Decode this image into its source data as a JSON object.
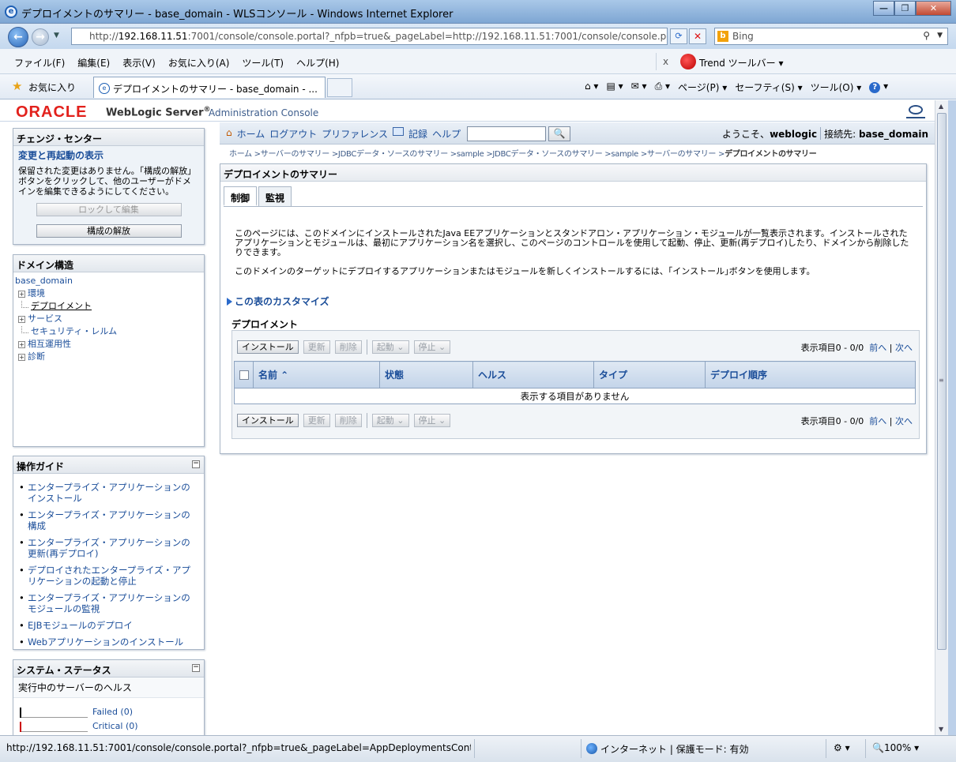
{
  "window": {
    "title": "デプロイメントのサマリー - base_domain - WLSコンソール - Windows Internet Explorer",
    "url_prefix": "http://",
    "url_host": "192.168.11.51",
    "url_rest": ":7001/console/console.portal?_nfpb=true&_pageLabel=http://192.168.11.51:7001/console/console.pc",
    "search_placeholder": "Bing"
  },
  "menubar": {
    "items": [
      "ファイル(F)",
      "編集(E)",
      "表示(V)",
      "お気に入り(A)",
      "ツール(T)",
      "ヘルプ(H)"
    ],
    "trend_close": "x",
    "trend_label": "Trend ツールバー ▾"
  },
  "favbar": {
    "favorites": "お気に入り",
    "tab_title": "デプロイメントのサマリー - base_domain - ...",
    "commands": [
      "ページ(P) ▾",
      "セーフティ(S) ▾",
      "ツール(O) ▾"
    ]
  },
  "console": {
    "oracle": "ORACLE",
    "product": "WebLogic Server",
    "reg": "®",
    "subtitle": "Administration Console"
  },
  "change_center": {
    "title": "チェンジ・センター",
    "link": "変更と再起動の表示",
    "message": "保留された変更はありません。｢構成の解放」ボタンをクリックして、他のユーザーがドメインを編集できるようにしてください。",
    "lock_button": "ロックして編集",
    "release_button": "構成の解放"
  },
  "domain_structure": {
    "title": "ドメイン構造",
    "root": "base_domain",
    "nodes": [
      {
        "label": "環境",
        "type": "plus"
      },
      {
        "label": "デプロイメント",
        "type": "leaf"
      },
      {
        "label": "サービス",
        "type": "plus"
      },
      {
        "label": "セキュリティ・レルム",
        "type": "leaf"
      },
      {
        "label": "相互運用性",
        "type": "plus"
      },
      {
        "label": "診断",
        "type": "plus"
      }
    ]
  },
  "how_to": {
    "title": "操作ガイド",
    "collapse": "−",
    "items": [
      "エンタープライズ・アプリケーションのインストール",
      "エンタープライズ・アプリケーションの構成",
      "エンタープライズ・アプリケーションの更新(再デプロイ)",
      "デプロイされたエンタープライズ・アプリケーションの起動と停止",
      "エンタープライズ・アプリケーションのモジュールの監視",
      "EJBモジュールのデプロイ",
      "Webアプリケーションのインストール"
    ]
  },
  "system_status": {
    "title": "システム・ステータス",
    "collapse": "−",
    "subtitle": "実行中のサーバーのヘルス",
    "rows": [
      {
        "label": "Failed (0)",
        "color": "#000000"
      },
      {
        "label": "Critical (0)",
        "color": "#cc0000"
      }
    ]
  },
  "topnav": {
    "home": "ホーム",
    "logout": "ログアウト",
    "preferences": "プリファレンス",
    "record": "記録",
    "help": "ヘルプ",
    "search_button": "🔍",
    "welcome": "ようこそ、",
    "user": "weblogic",
    "connected": "接続先:",
    "domain": "base_domain"
  },
  "breadcrumb": {
    "trail": "ホーム >サーバーのサマリー >JDBCデータ・ソースのサマリー >sample >JDBCデータ・ソースのサマリー >sample >サーバーのサマリー >",
    "current": "デプロイメントのサマリー"
  },
  "content": {
    "title": "デプロイメントのサマリー",
    "tabs": [
      "制御",
      "監視"
    ],
    "desc1": "このページには、このドメインにインストールされたJava EEアプリケーションとスタンドアロン・アプリケーション・モジュールが一覧表示されます。インストールされたアプリケーションとモジュールは、最初にアプリケーション名を選択し、このページのコントロールを使用して起動、停止、更新(再デプロイ)したり、ドメインから削除したりできます。",
    "desc2": "このドメインのターゲットにデプロイするアプリケーションまたはモジュールを新しくインストールするには、｢インストール｣ボタンを使用します。",
    "customize": "この表のカスタマイズ",
    "table_title": "デプロイメント",
    "buttons": {
      "install": "インストール",
      "update": "更新",
      "delete": "削除",
      "start": "起動",
      "stop": "停止"
    },
    "pager": {
      "range": "表示項目0 - 0/0",
      "prev": "前へ",
      "sep": "|",
      "next": "次へ"
    },
    "columns": [
      "名前 ⌃",
      "状態",
      "ヘルス",
      "タイプ",
      "デプロイ順序"
    ],
    "empty": "表示する項目がありません"
  },
  "statusbar": {
    "url": "http://192.168.11.51:7001/console/console.portal?_nfpb=true&_pageLabel=AppDeploymentsContro",
    "zone": "インターネット | 保護モード: 有効",
    "zoom": "🔍100%  ▾",
    "security": "⚙ ▾"
  }
}
